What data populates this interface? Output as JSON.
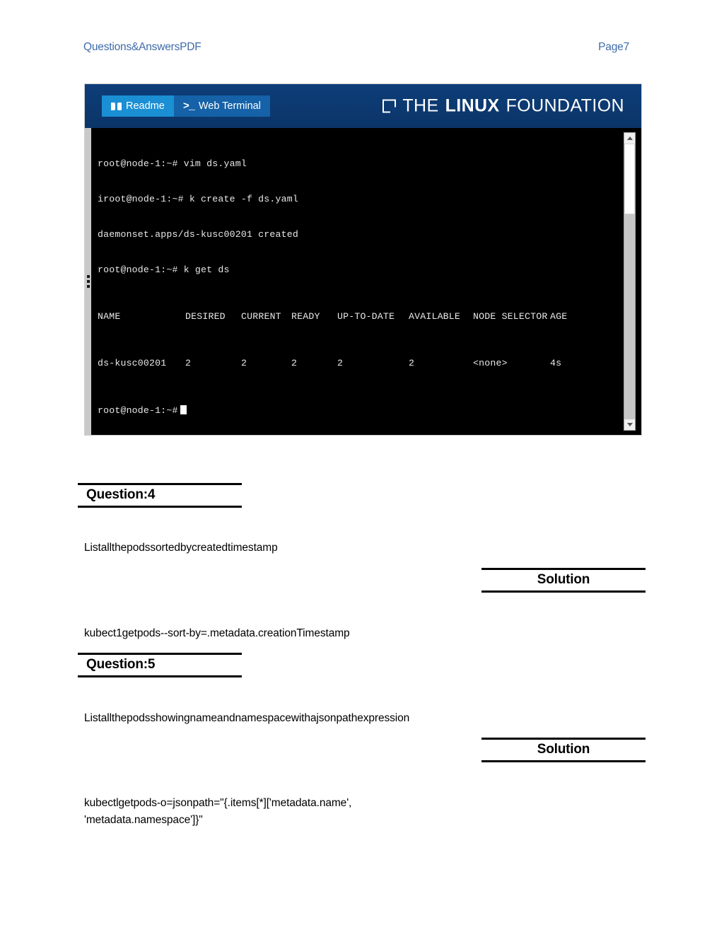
{
  "page_header": {
    "left_label": "Questions&AnswersPDF",
    "right_label": "Page7",
    "color": "#3f6ba8"
  },
  "terminal_window": {
    "topbar": {
      "background_color": "#0c3a72",
      "tabs": [
        {
          "label": "Readme",
          "icon": "book-icon",
          "active": true,
          "background_color": "#1a8fd4"
        },
        {
          "label": "Web Terminal",
          "icon": "prompt-icon",
          "active": false,
          "background_color": "#1562a8"
        }
      ],
      "logo": {
        "mark": "square-bracket-icon",
        "text_the": "THE",
        "text_linux": "LINUX",
        "text_foundation": "FOUNDATION"
      }
    },
    "console": {
      "background_color": "#000000",
      "text_color": "#e8e8e8",
      "lines": [
        "root@node-1:~# vim ds.yaml",
        "iroot@node-1:~# k create -f ds.yaml",
        "daemonset.apps/ds-kusc00201 created",
        "root@node-1:~# k get ds"
      ],
      "table": {
        "headers": [
          "NAME",
          "DESIRED",
          "CURRENT",
          "READY",
          "UP-TO-DATE",
          "AVAILABLE",
          "NODE SELECTOR",
          "AGE"
        ],
        "row": [
          "ds-kusc00201",
          "2",
          "2",
          "2",
          "2",
          "2",
          "<none>",
          "4s"
        ]
      },
      "final_prompt": "root@node-1:~#"
    },
    "scrollbar": {
      "up_arrow": "triangle-up-icon",
      "down_arrow": "triangle-down-icon"
    },
    "drag_handle": "vertical-drag-handle"
  },
  "content": {
    "question4": {
      "heading": "Question:4",
      "prompt": "Listallthepodssortedbycreatedtimestamp",
      "solution_label": "Solution",
      "answer": "kubect1getpods--sort-by=.metadata.creationTimestamp"
    },
    "question5": {
      "heading": "Question:5",
      "prompt": "Listallthepodsshowingnameandnamespacewithajsonpathexpression",
      "solution_label": "Solution",
      "answer_line1": "kubectlgetpods-o=jsonpath=\"{.items[*]['metadata.name',",
      "answer_line2": "'metadata.namespace']}\""
    }
  }
}
